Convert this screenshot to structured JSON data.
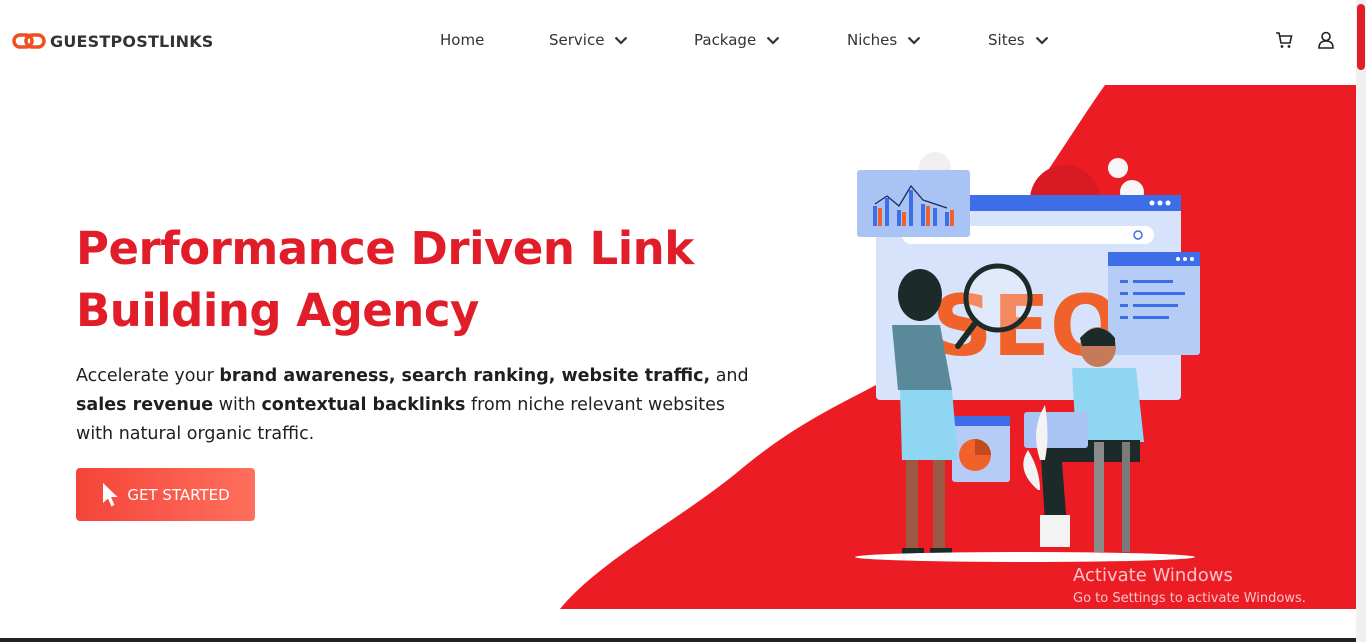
{
  "brand": {
    "name": "GUESTPOSTLINKS",
    "accent": "#e11d2a"
  },
  "nav": [
    {
      "label": "Home",
      "dropdown": false
    },
    {
      "label": "Service",
      "dropdown": true
    },
    {
      "label": "Package",
      "dropdown": true
    },
    {
      "label": "Niches",
      "dropdown": true
    },
    {
      "label": "Sites",
      "dropdown": true
    }
  ],
  "header_icons": [
    "cart-icon",
    "user-icon"
  ],
  "hero": {
    "title_line1": "Performance Driven Link",
    "title_line2": "Building Agency",
    "desc": {
      "t1": "Accelerate your ",
      "b1": "brand awareness, search ranking, website traffic,",
      "t2": " and ",
      "b2": "sales revenue",
      "t3": " with ",
      "b3": "contextual backlinks",
      "t4": " from niche relevant websites with natural organic traffic."
    },
    "cta_label": "GET STARTED"
  },
  "illustration": {
    "seo_text": "SEO"
  },
  "watermark": {
    "title": "Activate Windows",
    "subtitle": "Go to Settings to activate Windows."
  }
}
